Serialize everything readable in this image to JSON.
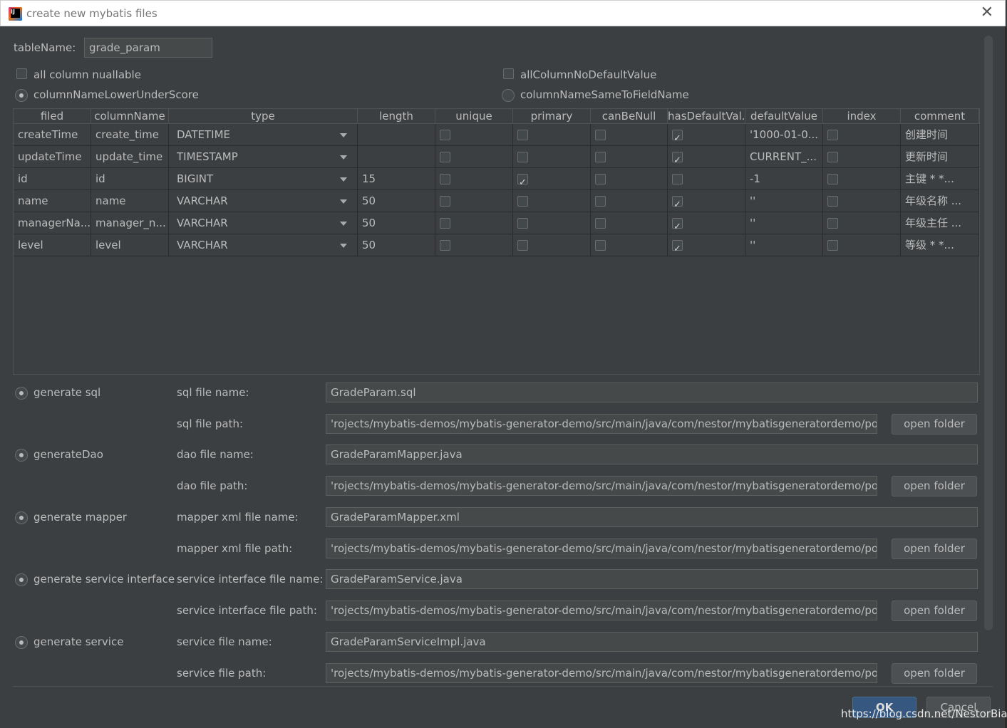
{
  "window": {
    "title": "create new mybatis files"
  },
  "table_name": {
    "label": "tableName:",
    "value": "grade_param"
  },
  "options": {
    "all_column_nullable": {
      "label": "all column nuallable",
      "checked": false
    },
    "all_column_no_default": {
      "label": "allColumnNoDefaultValue",
      "checked": false
    },
    "lower_under_score": {
      "label": "columnNameLowerUnderScore",
      "selected": true
    },
    "same_to_field": {
      "label": "columnNameSameToFieldName",
      "selected": false
    }
  },
  "table": {
    "headers": [
      "filed",
      "columnName",
      "type",
      "length",
      "unique",
      "primary",
      "canBeNull",
      "hasDefaultVal...",
      "defaultValue",
      "index",
      "comment"
    ],
    "rows": [
      {
        "filed": "createTime",
        "column": "create_time",
        "type": "DATETIME",
        "length": "",
        "unique": false,
        "primary": false,
        "null": false,
        "hasDefault": true,
        "default": "'1000-01-0...",
        "index": false,
        "comment": "创建时间"
      },
      {
        "filed": "updateTime",
        "column": "update_time",
        "type": "TIMESTAMP",
        "length": "",
        "unique": false,
        "primary": false,
        "null": false,
        "hasDefault": true,
        "default": "CURRENT_...",
        "index": false,
        "comment": "更新时间"
      },
      {
        "filed": "id",
        "column": "id",
        "type": "BIGINT",
        "length": "15",
        "unique": false,
        "primary": true,
        "null": false,
        "hasDefault": false,
        "default": "-1",
        "index": false,
        "comment": "主键    *    *..."
      },
      {
        "filed": "name",
        "column": "name",
        "type": "VARCHAR",
        "length": "50",
        "unique": false,
        "primary": false,
        "null": false,
        "hasDefault": true,
        "default": "''",
        "index": false,
        "comment": "年级名称    ..."
      },
      {
        "filed": "managerNa...",
        "column": "manager_n...",
        "type": "VARCHAR",
        "length": "50",
        "unique": false,
        "primary": false,
        "null": false,
        "hasDefault": true,
        "default": "''",
        "index": false,
        "comment": "年级主任    ..."
      },
      {
        "filed": "level",
        "column": "level",
        "type": "VARCHAR",
        "length": "50",
        "unique": false,
        "primary": false,
        "null": false,
        "hasDefault": true,
        "default": "''",
        "index": false,
        "comment": "等级    *    *..."
      }
    ]
  },
  "generators": [
    {
      "label": "generate sql",
      "selected": true,
      "name_label": "sql file name:",
      "name_value": "GradeParam.sql",
      "path_label": "sql file path:",
      "path_value": "'rojects/mybatis-demos/mybatis-generator-demo/src/main/java/com/nestor/mybatisgeneratordemo/po",
      "button": "open folder"
    },
    {
      "label": "generateDao",
      "selected": true,
      "name_label": "dao file name:",
      "name_value": "GradeParamMapper.java",
      "path_label": "dao file path:",
      "path_value": "'rojects/mybatis-demos/mybatis-generator-demo/src/main/java/com/nestor/mybatisgeneratordemo/po",
      "button": "open folder"
    },
    {
      "label": "generate mapper",
      "selected": true,
      "name_label": "mapper xml file name:",
      "name_value": "GradeParamMapper.xml",
      "path_label": "mapper xml file path:",
      "path_value": "'rojects/mybatis-demos/mybatis-generator-demo/src/main/java/com/nestor/mybatisgeneratordemo/po",
      "button": "open folder"
    },
    {
      "label": "generate service interface",
      "selected": true,
      "name_label": "service interface file name:",
      "name_value": "GradeParamService.java",
      "path_label": "service interface file path:",
      "path_value": "'rojects/mybatis-demos/mybatis-generator-demo/src/main/java/com/nestor/mybatisgeneratordemo/po",
      "button": "open folder"
    },
    {
      "label": "generate service",
      "selected": true,
      "name_label": "service file name:",
      "name_value": "GradeParamServiceImpl.java",
      "path_label": "service file path:",
      "path_value": "'rojects/mybatis-demos/mybatis-generator-demo/src/main/java/com/nestor/mybatisgeneratordemo/po",
      "button": "open folder"
    }
  ],
  "footer": {
    "ok": "OK",
    "cancel": "Cancel",
    "watermark": "https://blog.csdn.net/NestorBian"
  }
}
